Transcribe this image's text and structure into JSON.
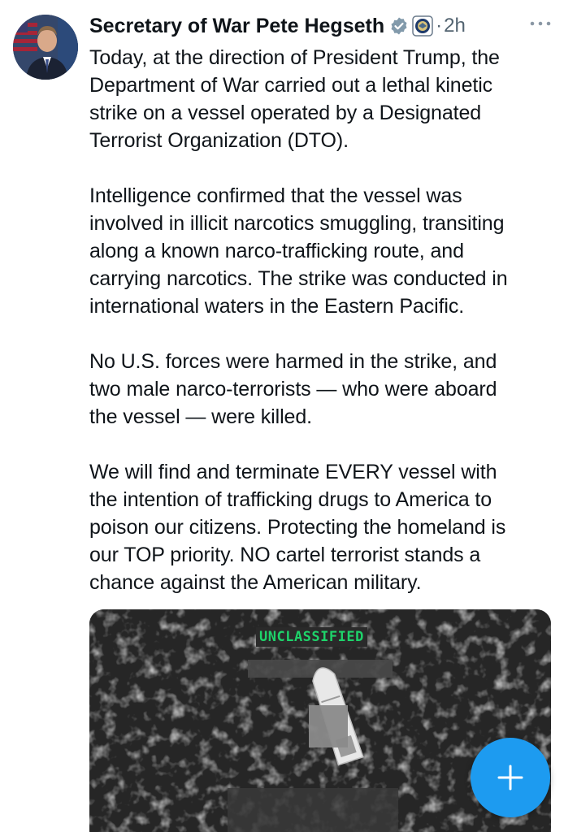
{
  "tweet": {
    "author_name": "Secretary of War Pete Hegseth",
    "separator": "·",
    "timestamp": "2h",
    "paragraphs": [
      "Today, at the direction of President Trump, the\nDepartment of War carried out a lethal kinetic\nstrike on a vessel operated by a Designated\nTerrorist Organization (DTO).",
      "Intelligence confirmed that the vessel was\ninvolved in illicit narcotics smuggling, transiting\nalong a known narco-trafficking route, and\ncarrying narcotics. The strike was conducted in\ninternational waters in the Eastern Pacific.",
      "No U.S. forces were harmed in the strike, and\ntwo male narco-terrorists — who were aboard\nthe vessel — were killed.",
      "We will find and terminate EVERY vessel with\nthe intention of trafficking drugs to America to\npoison our citizens. Protecting the homeland is\nour TOP priority. NO cartel terrorist stands a\nchance against the American military."
    ]
  },
  "media": {
    "overlay_label": "UNCLASSIFIED"
  },
  "icons": {
    "verified": "verified-badge-icon",
    "affiliate": "dod-seal-icon",
    "more": "more-options-icon",
    "compose": "plus-icon"
  },
  "colors": {
    "accent": "#1d9bf0",
    "secondary_text": "#536471",
    "overlay_text": "#1ed36a"
  }
}
